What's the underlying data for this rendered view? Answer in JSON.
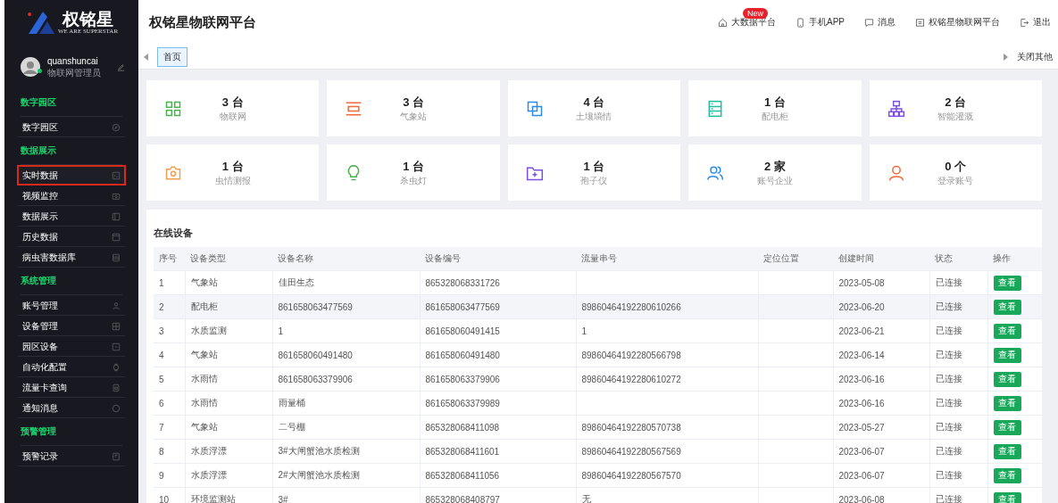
{
  "sidebar": {
    "logo": {
      "name": "权铭星",
      "tagline": "WE ARE SUPERSTAR"
    },
    "user": {
      "name": "quanshuncai",
      "role": "物联网管理员",
      "online": true
    },
    "sections": [
      {
        "title": "数字园区",
        "items": [
          {
            "label": "数字园区",
            "highlighted": false
          }
        ]
      },
      {
        "title": "数据展示",
        "items": [
          {
            "label": "实时数据",
            "highlighted": true
          },
          {
            "label": "视频监控",
            "highlighted": false
          },
          {
            "label": "数据展示",
            "highlighted": false
          },
          {
            "label": "历史数据",
            "highlighted": false
          },
          {
            "label": "病虫害数据库",
            "highlighted": false
          }
        ]
      },
      {
        "title": "系统管理",
        "items": [
          {
            "label": "账号管理",
            "highlighted": false
          },
          {
            "label": "设备管理",
            "highlighted": false
          },
          {
            "label": "园区设备",
            "highlighted": false
          },
          {
            "label": "自动化配置",
            "highlighted": false
          },
          {
            "label": "流量卡查询",
            "highlighted": false
          },
          {
            "label": "通知消息",
            "highlighted": false
          }
        ]
      },
      {
        "title": "预警管理",
        "items": [
          {
            "label": "预警记录",
            "highlighted": false
          }
        ]
      }
    ]
  },
  "header": {
    "title": "权铭星物联网平台",
    "nav": [
      {
        "label": "大数据平台",
        "badge": "New"
      },
      {
        "label": "手机APP"
      },
      {
        "label": "消息"
      },
      {
        "label": "权铭星物联网平台"
      },
      {
        "label": "退出"
      }
    ]
  },
  "tabs": [
    {
      "label": "首页",
      "selected": true
    }
  ],
  "close_others": "关闭其他",
  "stats": [
    {
      "value": "3 台",
      "label": "物联网",
      "color": "#4caf50"
    },
    {
      "value": "3 台",
      "label": "气象站",
      "color": "#f06a3c"
    },
    {
      "value": "4 台",
      "label": "土壤墒情",
      "color": "#2f8ae5"
    },
    {
      "value": "1 台",
      "label": "配电柜",
      "color": "#1fbf9f"
    },
    {
      "value": "2 台",
      "label": "智能灌溉",
      "color": "#7b4fe0"
    },
    {
      "value": "1 台",
      "label": "虫情测报",
      "color": "#f0a050"
    },
    {
      "value": "1 台",
      "label": "杀虫灯",
      "color": "#4caf50"
    },
    {
      "value": "1 台",
      "label": "孢子仪",
      "color": "#7b4fe0"
    },
    {
      "value": "2 家",
      "label": "账号企业",
      "color": "#2f8ae5"
    },
    {
      "value": "0 个",
      "label": "登录账号",
      "color": "#f06a3c"
    }
  ],
  "table": {
    "title": "在线设备",
    "columns": [
      "序号",
      "设备类型",
      "设备名称",
      "设备编号",
      "流量串号",
      "定位位置",
      "创建时间",
      "状态",
      "操作"
    ],
    "rows": [
      {
        "cells": [
          "1",
          "气象站",
          "佳田生态",
          "865328068331726",
          "",
          "",
          "2023-05-08",
          "已连接"
        ],
        "action": "查看",
        "highlighted": false
      },
      {
        "cells": [
          "2",
          "配电柜",
          "861658063477569",
          "861658063477569",
          "89860464192280610266",
          "",
          "2023-06-20",
          "已连接"
        ],
        "action": "查看",
        "highlighted": true
      },
      {
        "cells": [
          "3",
          "水质监测",
          "1",
          "861658060491415",
          "1",
          "",
          "2023-06-21",
          "已连接"
        ],
        "action": "查看",
        "highlighted": false
      },
      {
        "cells": [
          "4",
          "气象站",
          "861658060491480",
          "861658060491480",
          "89860464192280566798",
          "",
          "2023-06-14",
          "已连接"
        ],
        "action": "查看",
        "highlighted": false
      },
      {
        "cells": [
          "5",
          "水雨情",
          "861658063379906",
          "861658063379906",
          "89860464192280610272",
          "",
          "2023-06-16",
          "已连接"
        ],
        "action": "查看",
        "highlighted": false
      },
      {
        "cells": [
          "6",
          "水雨情",
          "雨量桶",
          "861658063379989",
          "",
          "",
          "2023-06-16",
          "已连接"
        ],
        "action": "查看",
        "highlighted": false
      },
      {
        "cells": [
          "7",
          "气象站",
          "二号棚",
          "865328068411098",
          "89860464192280570738",
          "",
          "2023-05-27",
          "已连接"
        ],
        "action": "查看",
        "highlighted": false
      },
      {
        "cells": [
          "8",
          "水质浮漂",
          "3#大闸蟹池水质检测",
          "865328068411601",
          "89860464192280567569",
          "",
          "2023-06-07",
          "已连接"
        ],
        "action": "查看",
        "highlighted": false
      },
      {
        "cells": [
          "9",
          "水质浮漂",
          "2#大闸蟹池水质检测",
          "865328068411056",
          "89860464192280567570",
          "",
          "2023-06-07",
          "已连接"
        ],
        "action": "查看",
        "highlighted": false
      },
      {
        "cells": [
          "10",
          "环境监测站",
          "3#",
          "865328068408797",
          "无",
          "",
          "2023-06-08",
          "已连接"
        ],
        "action": "查看",
        "highlighted": false
      }
    ]
  }
}
